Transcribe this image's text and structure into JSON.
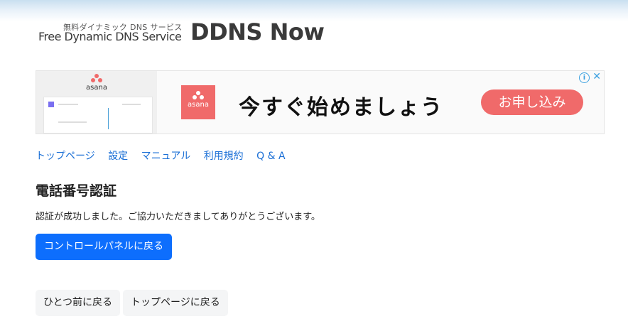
{
  "logo": {
    "subtitle": "無料ダイナミック DNS サービス",
    "tagline": "Free Dynamic DNS Service",
    "name": "DDNS Now"
  },
  "ad": {
    "brand": "asana",
    "headline": "今すぐ始めましょう",
    "cta": "お申し込み",
    "info_icon": "info-icon",
    "close_icon": "close-icon",
    "accent": "#f06a6a"
  },
  "nav": [
    {
      "label": "トップページ"
    },
    {
      "label": "設定"
    },
    {
      "label": "マニュアル"
    },
    {
      "label": "利用規約"
    },
    {
      "label": "Q & A"
    }
  ],
  "page": {
    "title": "電話番号認証",
    "message": "認証が成功しました。ご協力いただきましてありがとうございます。",
    "primary_button": "コントロールパネルに戻る",
    "back_button": "ひとつ前に戻る",
    "top_button": "トップページに戻る"
  },
  "colors": {
    "link": "#1a6fd6",
    "primary": "#0d6efd"
  }
}
